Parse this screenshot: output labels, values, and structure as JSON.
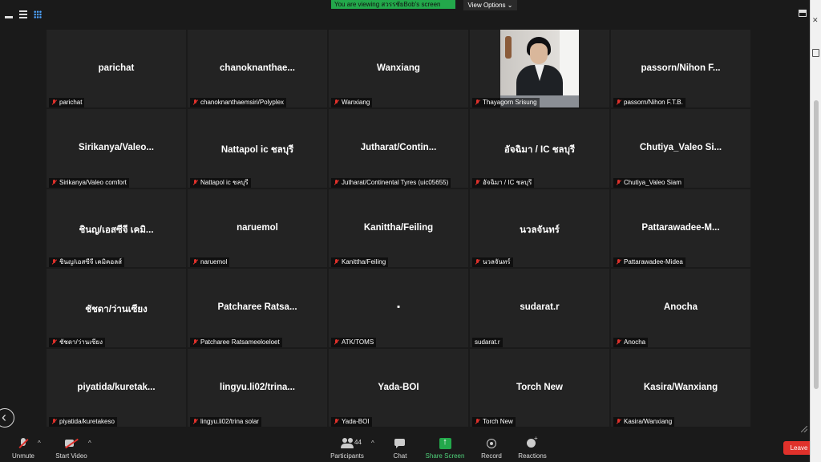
{
  "topbar": {
    "viewing_banner": "You are viewing สวรรชัยBob's screen",
    "view_options_label": "View Options ⌄"
  },
  "participants_grid": [
    {
      "display": "parichat",
      "label": "parichat"
    },
    {
      "display": "chanoknanthae...",
      "label": "chanoknanthaemsiri/Polyplex"
    },
    {
      "display": "Wanxiang",
      "label": "Wanxiang"
    },
    {
      "display": "",
      "label": "Thayagorn Srisung",
      "video": true
    },
    {
      "display": "passorn/Nihon F...",
      "label": "passorn/Nihon F.T.B."
    },
    {
      "display": "Sirikanya/Valeo...",
      "label": "Sirikanya/Valeo comfort"
    },
    {
      "display": "Nattapol ic ชลบุรี",
      "label": "Nattapol ic ชลบุรี"
    },
    {
      "display": "Jutharat/Contin...",
      "label": "Jutharat/Continental Tyres (uic05655)"
    },
    {
      "display": "อัจฉิมา / IC ชลบุรี",
      "label": "อัจฉิมา / IC ชลบุรี"
    },
    {
      "display": "Chutiya_Valeo Si...",
      "label": "Chutiya_Valeo Siam"
    },
    {
      "display": "ชินญ/เอสซีจี เคมิ...",
      "label": "ชินญ/เอสซีจี เคมิคอลส์"
    },
    {
      "display": "naruemol",
      "label": "naruemol"
    },
    {
      "display": "Kanittha/Feiling",
      "label": "Kanittha/Feiling"
    },
    {
      "display": "นวลจันทร์",
      "label": "นวลจันทร์"
    },
    {
      "display": "Pattarawadee-M...",
      "label": "Pattarawadee-Midea"
    },
    {
      "display": "ชัชดา/ว่านเซียง",
      "label": "ชัชดา/ว่านเซียง"
    },
    {
      "display": "Patcharee Ratsa...",
      "label": "Patcharee Ratsameeloeloet"
    },
    {
      "display": "▪",
      "label": "ATK/TOMS"
    },
    {
      "display": "sudarat.r",
      "label": "sudarat.r",
      "unmuted": true
    },
    {
      "display": "Anocha",
      "label": "Anocha"
    },
    {
      "display": "piyatida/kuretak...",
      "label": "piyatida/kuretakeso"
    },
    {
      "display": "lingyu.li02/trina...",
      "label": "lingyu.li02/trina solar"
    },
    {
      "display": "Yada-BOI",
      "label": "Yada-BOI"
    },
    {
      "display": "Torch New",
      "label": "Torch New"
    },
    {
      "display": "Kasira/Wanxiang",
      "label": "Kasira/Wanxiang"
    }
  ],
  "toolbar": {
    "unmute_label": "Unmute",
    "start_video_label": "Start Video",
    "participants_label": "Participants",
    "participants_count": "44",
    "chat_label": "Chat",
    "share_screen_label": "Share Screen",
    "record_label": "Record",
    "reactions_label": "Reactions",
    "leave_label": "Leave"
  },
  "colors": {
    "tile_bg": "#232323",
    "app_bg": "#1a1a1a",
    "muted_red": "#e0312b",
    "share_green": "#23a84b",
    "leave_red": "#e0312b"
  },
  "icons": [
    "minimize-icon",
    "speaker-view-icon",
    "gallery-view-icon",
    "fullscreen-icon",
    "mic-muted-icon",
    "video-off-icon",
    "participants-icon",
    "chat-icon",
    "share-screen-icon",
    "record-icon",
    "reactions-icon",
    "chevron-left-icon"
  ]
}
